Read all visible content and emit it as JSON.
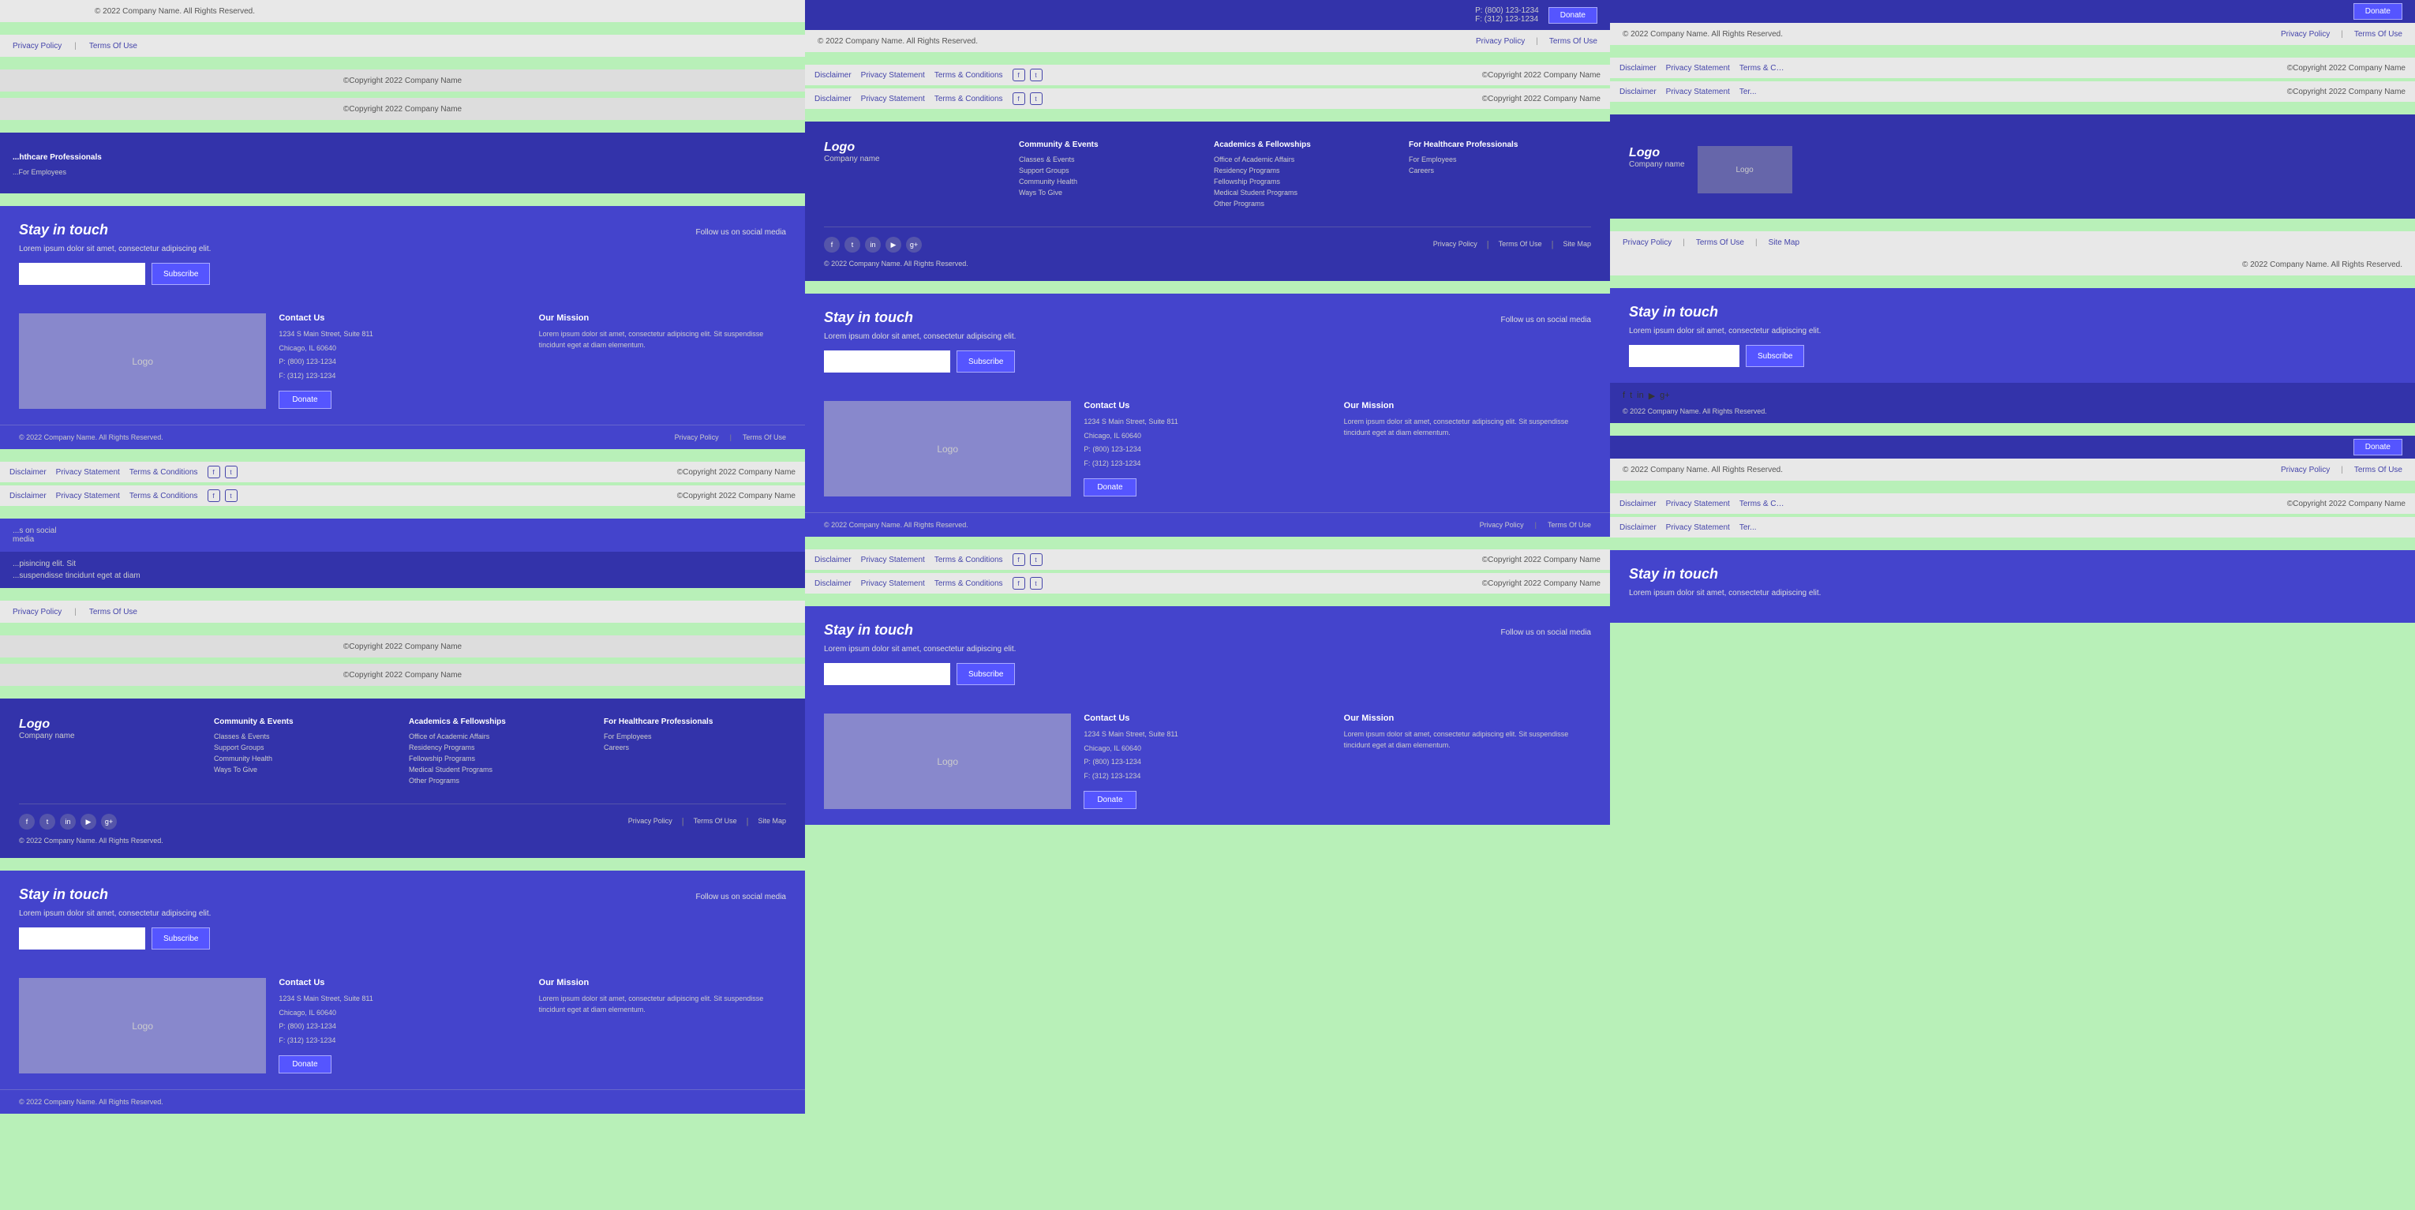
{
  "colors": {
    "green_bg": "#b8f0b8",
    "purple_dark": "#3333aa",
    "purple_mid": "#4444cc",
    "purple_light": "#8888cc",
    "gray_bg": "#e8e8e8"
  },
  "company": {
    "name": "Company Name",
    "copyright": "© 2022 Company Name. All Rights Reserved.",
    "copyright_short": "©Copyright 2022 Company Name"
  },
  "links": {
    "privacy": "Privacy Policy",
    "terms": "Terms Of Use",
    "sitemap": "Site Map",
    "disclaimer": "Disclaimer",
    "privacy_statement": "Privacy Statement",
    "terms_conditions": "Terms & Conditions"
  },
  "contact": {
    "heading": "Contact Us",
    "address1": "1234 S Main Street, Suite 811",
    "address2": "Chicago, IL 60640",
    "phone": "P: (800) 123-1234",
    "fax": "F: (312) 123-1234"
  },
  "mission": {
    "heading": "Our Mission",
    "text": "Lorem ipsum dolor sit amet, consectetur adipiscing elit. Sit suspendisse tincidunt eget at diam elementum."
  },
  "newsletter": {
    "heading": "Stay in touch",
    "subtext": "Lorem ipsum dolor sit amet, consectetur adipiscing elit.",
    "placeholder": "",
    "subscribe_label": "Subscribe",
    "follow_label": "Follow us on social media"
  },
  "nav": {
    "community": {
      "heading": "Community & Events",
      "items": [
        "Classes & Events",
        "Support Groups",
        "Community Health",
        "Ways To Give"
      ]
    },
    "academics": {
      "heading": "Academics & Fellowships",
      "items": [
        "Office of Academic Affairs",
        "Residency Programs",
        "Fellowship Programs",
        "Medical Student Programs",
        "Other Programs"
      ]
    },
    "healthcare": {
      "heading": "For Healthcare Professionals",
      "items": [
        "For Employees",
        "Careers"
      ]
    }
  },
  "logo": {
    "text": "Logo",
    "company": "Company name"
  },
  "donate_label": "Donate",
  "social_icons": [
    "f",
    "t",
    "in",
    "yt",
    "gp"
  ]
}
